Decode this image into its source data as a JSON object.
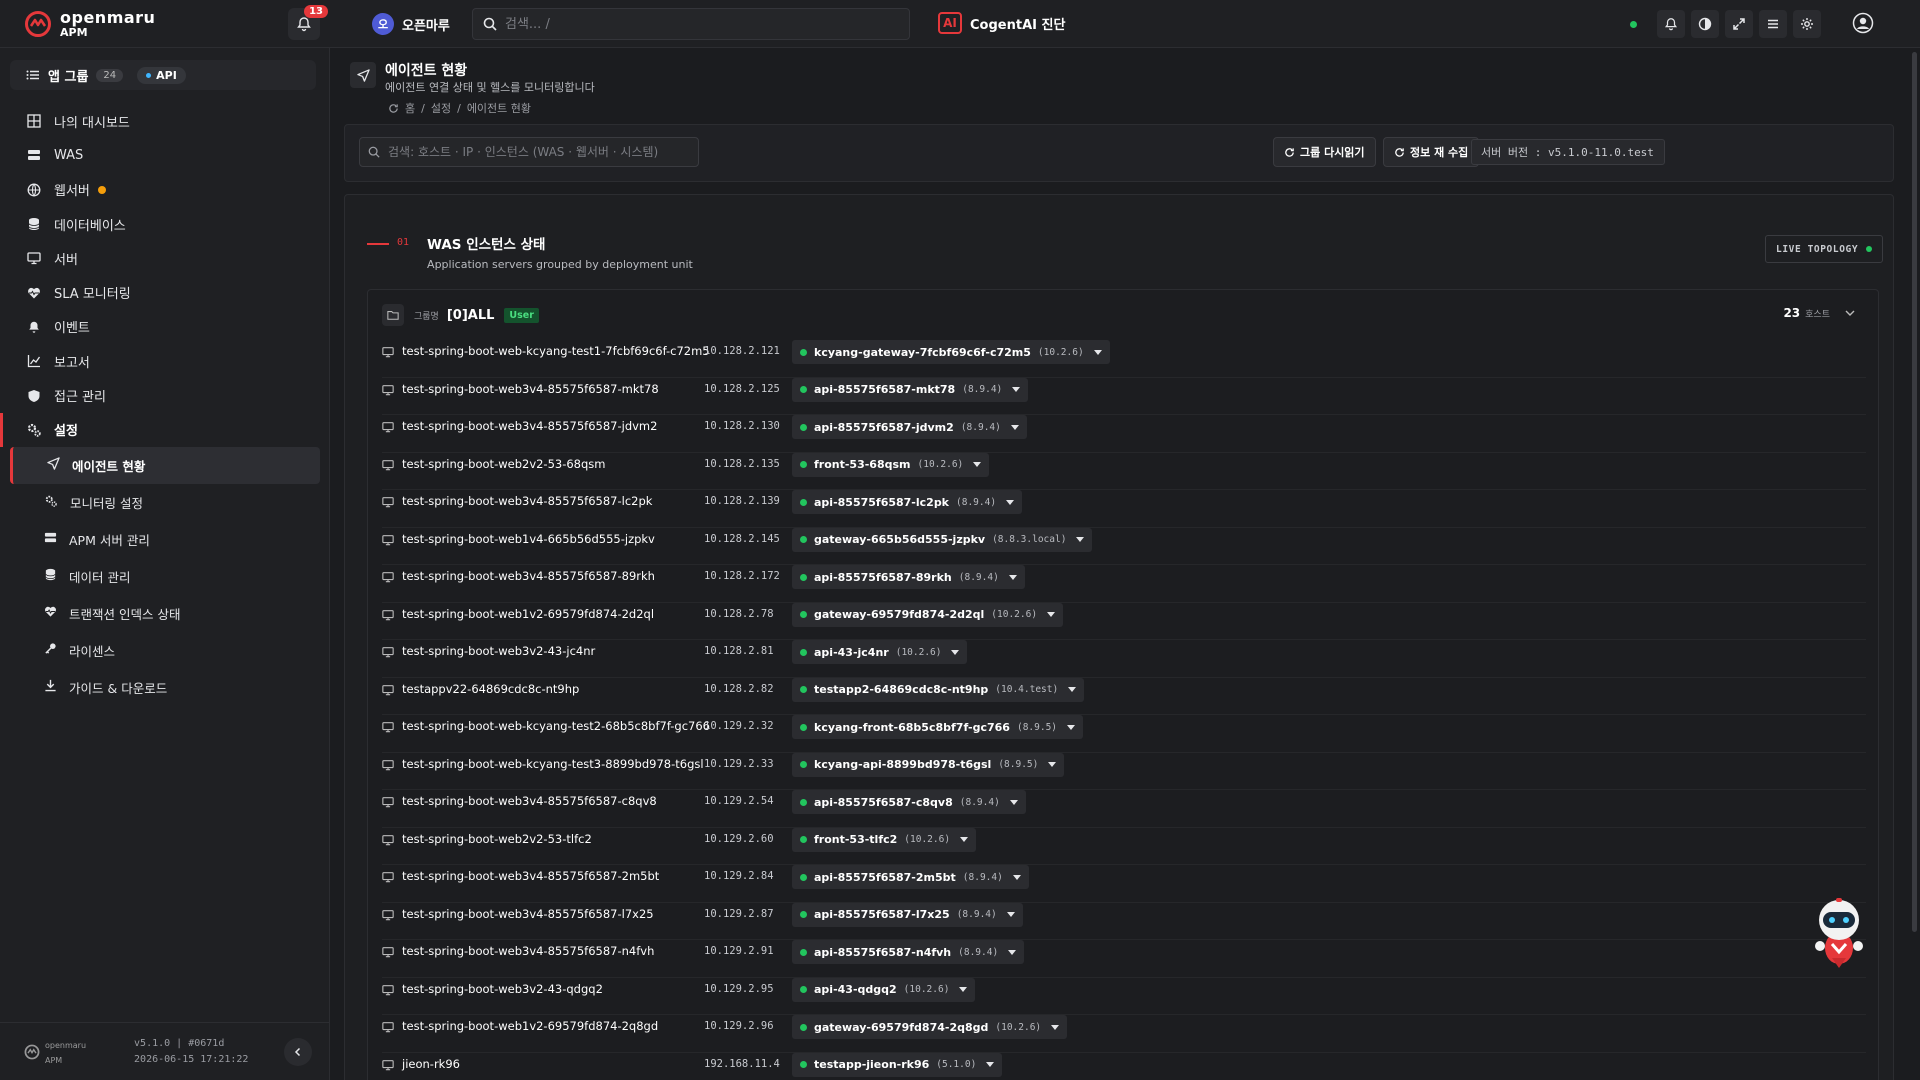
{
  "app": {
    "logo_name": "openmaru",
    "logo_sub": "APM",
    "notifications_count": "13",
    "tenant_initial": "오",
    "tenant_name": "오픈마루",
    "search_placeholder": "검색... /",
    "cogent_logo": "AI",
    "cogent_label": "CogentAI 진단",
    "accent_color": "#e5383b",
    "ok_color": "#22c55e"
  },
  "sidebar": {
    "app_group_label": "앱 그룹",
    "app_group_count": "24",
    "api_label": "API",
    "nav": [
      {
        "label": "나의 대시보드",
        "icon": "dashboard-icon"
      },
      {
        "label": "WAS",
        "icon": "server-stack-icon"
      },
      {
        "label": "웹서버",
        "icon": "globe-icon",
        "warning": true
      },
      {
        "label": "데이터베이스",
        "icon": "database-icon"
      },
      {
        "label": "서버",
        "icon": "monitor-icon"
      },
      {
        "label": "SLA 모니터링",
        "icon": "heart-pulse-icon"
      },
      {
        "label": "이벤트",
        "icon": "bell-icon"
      },
      {
        "label": "보고서",
        "icon": "chart-icon"
      },
      {
        "label": "접근 관리",
        "icon": "shield-icon"
      },
      {
        "label": "설정",
        "icon": "gears-icon"
      }
    ],
    "settings_sub": [
      {
        "label": "에이전트 현황",
        "icon": "send-icon",
        "active": true
      },
      {
        "label": "모니터링 설정",
        "icon": "gears-icon"
      },
      {
        "label": "APM 서버 관리",
        "icon": "server-stack-icon"
      },
      {
        "label": "데이터 관리",
        "icon": "database-icon"
      },
      {
        "label": "트랜잭션 인덱스 상태",
        "icon": "heart-pulse-icon"
      },
      {
        "label": "라이센스",
        "icon": "key-icon"
      },
      {
        "label": "가이드 & 다운로드",
        "icon": "download-icon"
      }
    ],
    "footer_logo": "openmaru",
    "footer_logo_sub": "APM",
    "footer_version": "v5.1.0 | #0671d",
    "footer_date": "2026-06-15 17:21:22"
  },
  "page": {
    "title": "에이전트 현황",
    "subtitle": "에이전트 연결 상태 및 헬스를 모니터링합니다",
    "breadcrumb": [
      "홈",
      "설정",
      "에이전트 현황"
    ],
    "breadcrumb_sep": "/",
    "search_placeholder": "검색: 호스트 · IP · 인스턴스 (WAS · 웹서버 · 시스템)",
    "reload_groups_label": "그룹 다시읽기",
    "recollect_label": "정보 재 수집",
    "server_version": "서버 버전 : v5.1.0-11.0.test"
  },
  "section": {
    "number": "01",
    "title": "WAS 인스턴스 상태",
    "subtitle": "Application servers grouped by deployment unit",
    "live_topology": "LIVE TOPOLOGY"
  },
  "group": {
    "label": "그룹명",
    "name": "[0]ALL",
    "tag": "User",
    "host_count": "23",
    "host_unit": "호스트",
    "rows": [
      {
        "host": "test-spring-boot-web-kcyang-test1-7fcbf69c6f-c72m5",
        "ip": "10.128.2.121",
        "instance": "kcyang-gateway-7fcbf69c6f-c72m5",
        "version": "(10.2.6)"
      },
      {
        "host": "test-spring-boot-web3v4-85575f6587-mkt78",
        "ip": "10.128.2.125",
        "instance": "api-85575f6587-mkt78",
        "version": "(8.9.4)"
      },
      {
        "host": "test-spring-boot-web3v4-85575f6587-jdvm2",
        "ip": "10.128.2.130",
        "instance": "api-85575f6587-jdvm2",
        "version": "(8.9.4)"
      },
      {
        "host": "test-spring-boot-web2v2-53-68qsm",
        "ip": "10.128.2.135",
        "instance": "front-53-68qsm",
        "version": "(10.2.6)"
      },
      {
        "host": "test-spring-boot-web3v4-85575f6587-lc2pk",
        "ip": "10.128.2.139",
        "instance": "api-85575f6587-lc2pk",
        "version": "(8.9.4)"
      },
      {
        "host": "test-spring-boot-web1v4-665b56d555-jzpkv",
        "ip": "10.128.2.145",
        "instance": "gateway-665b56d555-jzpkv",
        "version": "(8.8.3.local)"
      },
      {
        "host": "test-spring-boot-web3v4-85575f6587-89rkh",
        "ip": "10.128.2.172",
        "instance": "api-85575f6587-89rkh",
        "version": "(8.9.4)"
      },
      {
        "host": "test-spring-boot-web1v2-69579fd874-2d2ql",
        "ip": "10.128.2.78",
        "instance": "gateway-69579fd874-2d2ql",
        "version": "(10.2.6)"
      },
      {
        "host": "test-spring-boot-web3v2-43-jc4nr",
        "ip": "10.128.2.81",
        "instance": "api-43-jc4nr",
        "version": "(10.2.6)"
      },
      {
        "host": "testappv22-64869cdc8c-nt9hp",
        "ip": "10.128.2.82",
        "instance": "testapp2-64869cdc8c-nt9hp",
        "version": "(10.4.test)"
      },
      {
        "host": "test-spring-boot-web-kcyang-test2-68b5c8bf7f-gc766",
        "ip": "10.129.2.32",
        "instance": "kcyang-front-68b5c8bf7f-gc766",
        "version": "(8.9.5)"
      },
      {
        "host": "test-spring-boot-web-kcyang-test3-8899bd978-t6gsl",
        "ip": "10.129.2.33",
        "instance": "kcyang-api-8899bd978-t6gsl",
        "version": "(8.9.5)"
      },
      {
        "host": "test-spring-boot-web3v4-85575f6587-c8qv8",
        "ip": "10.129.2.54",
        "instance": "api-85575f6587-c8qv8",
        "version": "(8.9.4)"
      },
      {
        "host": "test-spring-boot-web2v2-53-tlfc2",
        "ip": "10.129.2.60",
        "instance": "front-53-tlfc2",
        "version": "(10.2.6)"
      },
      {
        "host": "test-spring-boot-web3v4-85575f6587-2m5bt",
        "ip": "10.129.2.84",
        "instance": "api-85575f6587-2m5bt",
        "version": "(8.9.4)"
      },
      {
        "host": "test-spring-boot-web3v4-85575f6587-l7x25",
        "ip": "10.129.2.87",
        "instance": "api-85575f6587-l7x25",
        "version": "(8.9.4)"
      },
      {
        "host": "test-spring-boot-web3v4-85575f6587-n4fvh",
        "ip": "10.129.2.91",
        "instance": "api-85575f6587-n4fvh",
        "version": "(8.9.4)"
      },
      {
        "host": "test-spring-boot-web3v2-43-qdgq2",
        "ip": "10.129.2.95",
        "instance": "api-43-qdgq2",
        "version": "(10.2.6)"
      },
      {
        "host": "test-spring-boot-web1v2-69579fd874-2q8gd",
        "ip": "10.129.2.96",
        "instance": "gateway-69579fd874-2q8gd",
        "version": "(10.2.6)"
      },
      {
        "host": "jieon-rk96",
        "ip": "192.168.11.4",
        "instance": "testapp-jieon-rk96",
        "version": "(5.1.0)"
      }
    ]
  }
}
